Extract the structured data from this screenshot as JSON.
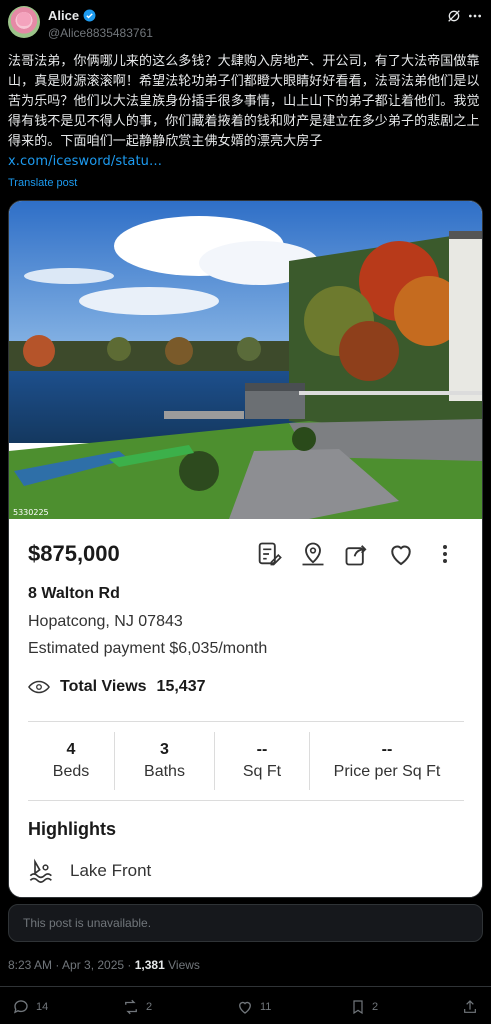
{
  "author": {
    "name": "Alice",
    "handle": "@Alice8835483761"
  },
  "post": {
    "text": "法哥法弟，你俩哪儿来的这么多钱？大肆购入房地产、开公司，有了大法帝国做靠山，真是财源滚滚啊！希望法轮功弟子们都瞪大眼睛好好看看，法哥法弟他们是以苦为乐吗？他们以大法皇族身份插手很多事情，山上山下的弟子都让着他们。我觉得有钱不是见不得人的事，你们藏着掖着的钱和财产是建立在多少弟子的悲剧之上得来的。下面咱们一起静静欣赏主佛女婿的漂亮大房子 ",
    "link": "x.com/icesword/statu…",
    "translate": "Translate post"
  },
  "listing": {
    "photo_id": "5330225",
    "price": "$875,000",
    "address": "8 Walton Rd",
    "city": "Hopatcong, NJ 07843",
    "estimate": "Estimated payment $6,035/month",
    "views_label": "Total Views",
    "views_value": "15,437",
    "stats": [
      {
        "value": "4",
        "label": "Beds"
      },
      {
        "value": "3",
        "label": "Baths"
      },
      {
        "value": "--",
        "label": "Sq Ft"
      },
      {
        "value": "--",
        "label": "Price per Sq Ft"
      }
    ],
    "highlights_title": "Highlights",
    "highlight_item": "Lake Front"
  },
  "quote": {
    "unavailable": "This post is unavailable."
  },
  "meta": {
    "time": "8:23 AM · Apr 3, 2025 · ",
    "views_count": "1,381",
    "views_word": " Views"
  },
  "actions": {
    "replies": "14",
    "reposts": "2",
    "likes": "11",
    "bookmarks": "2"
  },
  "colors": {
    "background": "#000000",
    "accent": "#1d9bf0",
    "muted": "#71767b"
  }
}
